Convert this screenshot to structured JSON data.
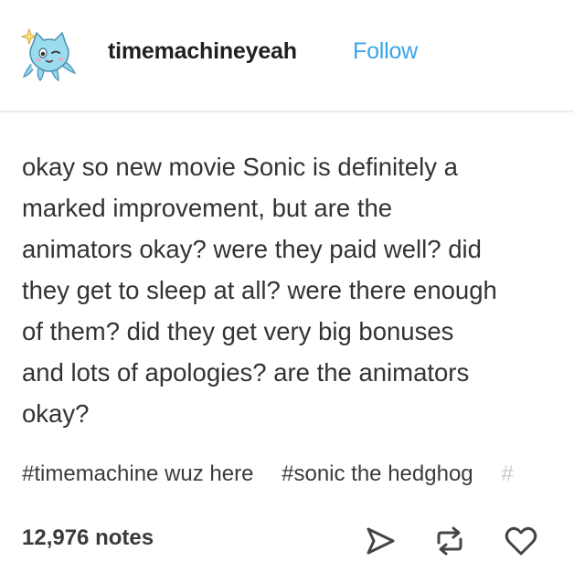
{
  "header": {
    "username": "timemachineyeah",
    "follow_label": "Follow"
  },
  "avatar": {
    "icon": "octopus-cat-avatar",
    "color": "#7fd1e6"
  },
  "post": {
    "lines": [
      "okay so new movie Sonic is definitely a",
      "marked improvement, but are the",
      "animators okay? were they paid well? did",
      "they get to sleep at all? were there enough",
      "of them? did they get very big bonuses",
      "and lots of apologies? are the animators",
      "okay?"
    ]
  },
  "tags": [
    "#timemachine wuz here",
    "#sonic the hedghog",
    "#"
  ],
  "footer": {
    "notes": "12,976 notes",
    "actions": [
      "share-icon",
      "reblog-icon",
      "heart-icon"
    ]
  },
  "colors": {
    "follow": "#3aa3e8",
    "text": "#333333",
    "icon": "#444444"
  }
}
